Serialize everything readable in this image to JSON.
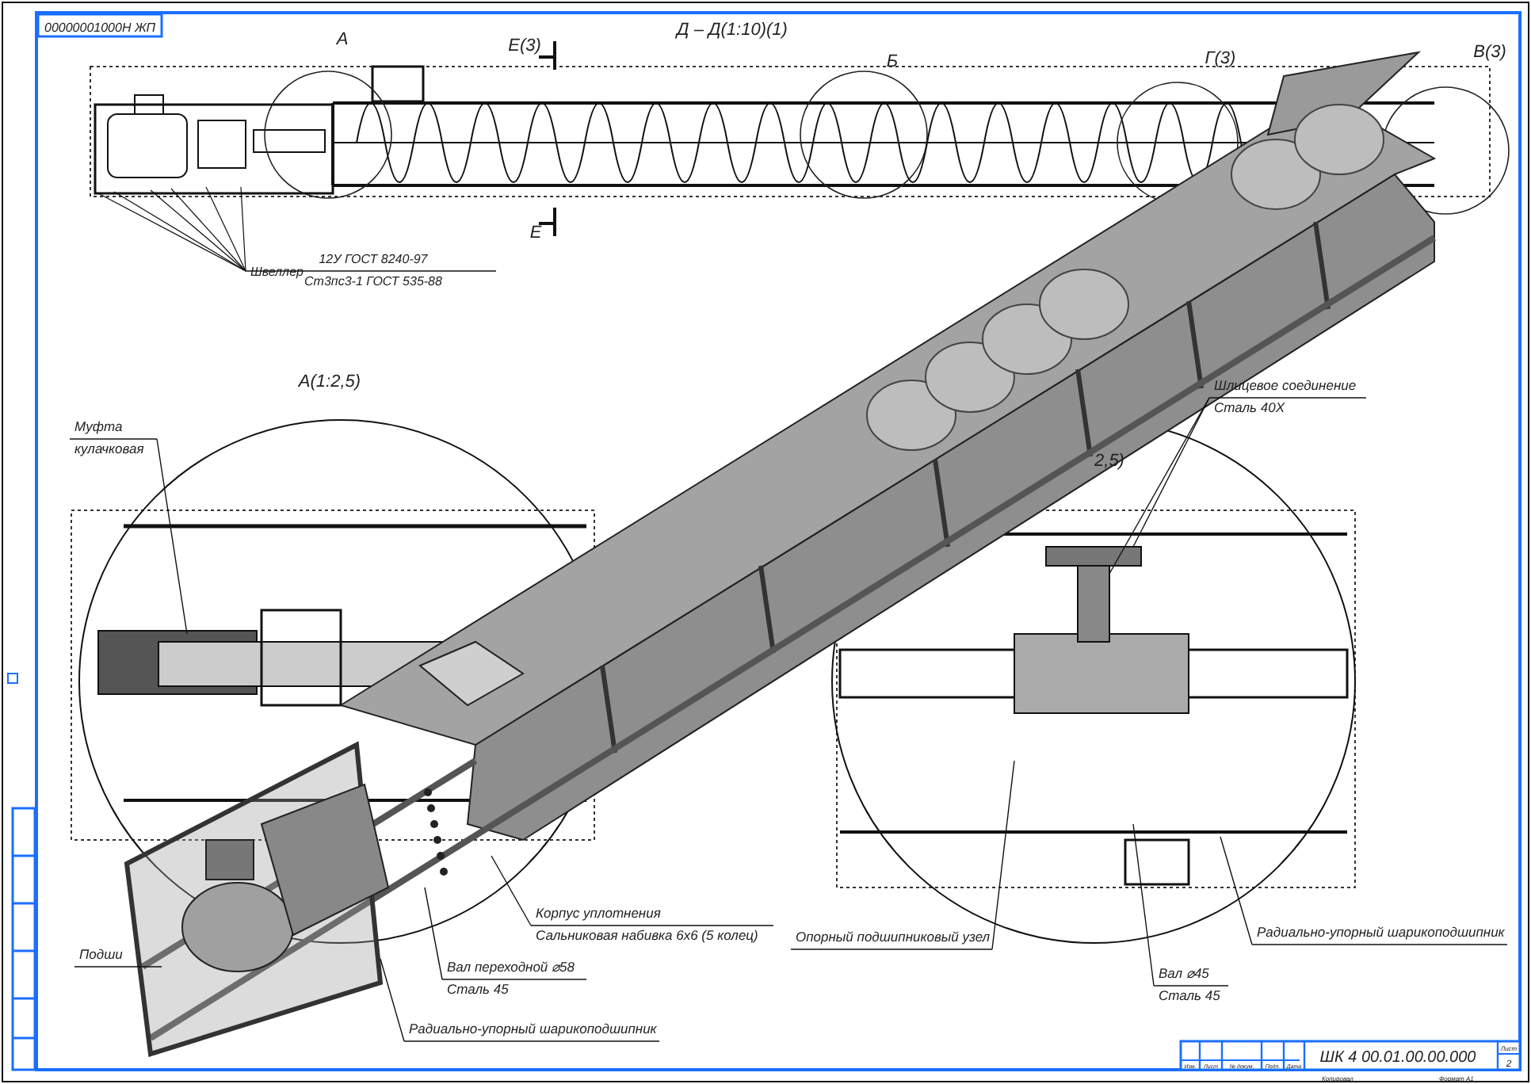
{
  "sheet": {
    "code_stamp": "00000001000Н ЖП"
  },
  "view_labels": [
    {
      "text": "Д – Д(1:10)(1)"
    },
    {
      "text": "Е(3)"
    },
    {
      "text": "Е"
    },
    {
      "text": "А"
    },
    {
      "text": "Б"
    },
    {
      "text": "Г(3)"
    },
    {
      "text": "В(3)"
    },
    {
      "text": "А(1:2,5)"
    },
    {
      "text": "2,5)"
    }
  ],
  "callouts": [
    {
      "kind": "fraction",
      "label": "Швеллер",
      "lines": [
        "12У ГОСТ 8240-97",
        "Ст3пс3-1 ГОСТ 535-88"
      ]
    },
    {
      "kind": "stacked",
      "lines": [
        "Муфта",
        "кулачковая"
      ]
    },
    {
      "kind": "stacked",
      "lines": [
        "Шлицевое соединение",
        "Сталь 40Х"
      ]
    },
    {
      "kind": "stacked",
      "lines": [
        "Корпус уплотнения",
        "Сальниковая набивка 6х6 (5 колец)"
      ]
    },
    {
      "kind": "stacked",
      "lines": [
        "Вал переходной ⌀58",
        "Сталь 45"
      ]
    },
    {
      "kind": "stacked",
      "lines": [
        "Радиально-упорный шарикоподшипник"
      ]
    },
    {
      "kind": "stacked",
      "lines": [
        "Опорный подшипниковый узел"
      ]
    },
    {
      "kind": "stacked",
      "lines": [
        "Вал ⌀45",
        "Сталь 45"
      ]
    },
    {
      "kind": "stacked",
      "lines": [
        "Радиально-упорный шарикоподшипник"
      ]
    },
    {
      "kind": "stacked",
      "lines": [
        "Подши"
      ]
    }
  ],
  "title_block": {
    "designation": "ШК 4 00.01.00.00.000",
    "columns": [
      "Изм.",
      "Лист",
      "№ докум.",
      "Подп.",
      "Дата"
    ],
    "sheet_label": "Лист",
    "sheet_number": "2",
    "copied": "Копировал",
    "format": "Формат А1"
  }
}
